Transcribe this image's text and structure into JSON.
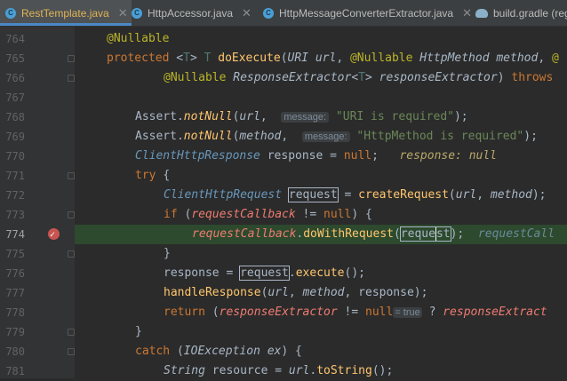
{
  "tabs": [
    {
      "name": "RestTemplate.java",
      "icon": "class-icon",
      "icon_letter": "C",
      "active": true
    },
    {
      "name": "HttpAccessor.java",
      "icon": "class-icon",
      "icon_letter": "C",
      "active": false
    },
    {
      "name": "HttpMessageConverterExtractor.java",
      "icon": "class-icon",
      "icon_letter": "C",
      "active": false
    },
    {
      "name": "build.gradle (reg",
      "icon": "gradle-icon",
      "active": false
    }
  ],
  "lines": [
    "764",
    "765",
    "766",
    "767",
    "768",
    "769",
    "770",
    "771",
    "772",
    "773",
    "774",
    "775",
    "776",
    "777",
    "778",
    "779",
    "780",
    "781"
  ],
  "current_line": "774",
  "code": {
    "l764": {
      "ann": "@Nullable"
    },
    "l765": {
      "a": "protected ",
      "b": "<",
      "c": "T",
      "d": "> ",
      "e": "T ",
      "f": "doExecute",
      "g": "(",
      "h": "URI ",
      "i": "url",
      "j": ", ",
      "k": "@Nullable ",
      "l": "HttpMethod ",
      "m": "method",
      ",": ", ",
      "n": "@"
    },
    "l766": {
      "a": "@Nullable ",
      "b": "ResponseExtractor",
      "c": "<",
      "d": "T",
      "e": "> ",
      "f": "responseExtractor",
      "g": ") ",
      "h": "throws "
    },
    "l768": {
      "a": "Assert",
      "b": ".",
      "c": "notNull",
      "d": "(",
      "e": "url",
      ",": ", ",
      "hint": "message:",
      "s": "\"URI is required\"",
      "t": ");"
    },
    "l769": {
      "a": "Assert",
      "b": ".",
      "c": "notNull",
      "d": "(",
      "e": "method",
      ",": ", ",
      "hint": "message:",
      "s": "\"HttpMethod is required\"",
      "t": ");"
    },
    "l770": {
      "a": "ClientHttpResponse ",
      "b": "response = ",
      "c": "null",
      "d": ";",
      "inl": "response: null"
    },
    "l771": {
      "a": "try ",
      "b": "{"
    },
    "l772": {
      "a": "ClientHttpRequest ",
      "b": "request",
      "c": " = ",
      "d": "createRequest",
      "e": "(",
      "f": "url",
      ",": ", ",
      "g": "method",
      "h": ");"
    },
    "l773": {
      "a": "if ",
      "b": "(",
      "c": "requestCallback",
      "d": " != ",
      "e": "null",
      "f": ") {"
    },
    "l774": {
      "a": "requestCallback",
      "b": ".",
      "c": "doWithRequest",
      "d": "(",
      "e1": "reque",
      "e2": "st",
      "f": ");",
      "inl": "requestCall"
    },
    "l775": {
      "a": "}"
    },
    "l776": {
      "a": "response = ",
      "b": "request",
      "c": ".",
      "d": "execute",
      "e": "();"
    },
    "l777": {
      "a": "handleResponse",
      "b": "(",
      "c": "url",
      ",": ", ",
      "d": "method",
      ",2": ", ",
      "e": "response",
      "f": ");"
    },
    "l778": {
      "a": "return ",
      "b": "(",
      "c": "responseExtractor",
      "d": " != ",
      "e": "null",
      "hint": "= true",
      "f": " ? ",
      "g": "responseExtract"
    },
    "l779": {
      "a": "}"
    },
    "l780": {
      "a": "catch ",
      "b": "(",
      "c": "IOException ",
      "d": "ex",
      "e": ") {"
    },
    "l781": {
      "a": "String ",
      "b": "resource = ",
      "c": "url",
      "d": ".",
      "e": "toString",
      "f": "();"
    }
  },
  "colors": {
    "background": "#2b2b2b",
    "gutter": "#313335",
    "execution_line": "#2d4a2e",
    "breakpoint": "#c75450",
    "keyword": "#cc7832",
    "string": "#6a8759",
    "method": "#ffc66d"
  }
}
